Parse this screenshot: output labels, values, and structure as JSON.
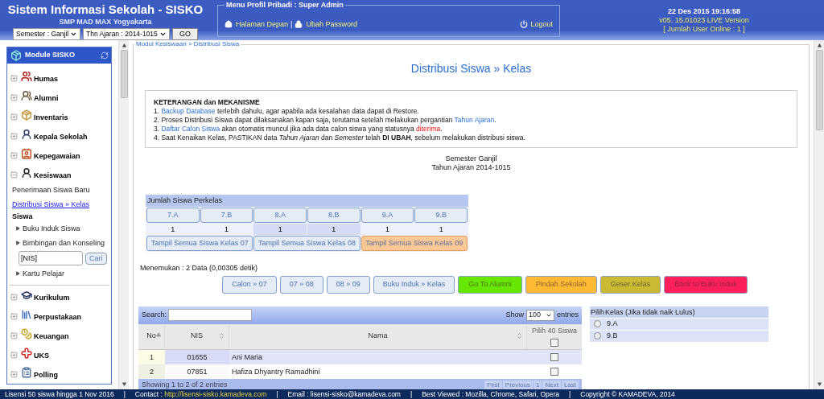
{
  "header": {
    "title": "Sistem Informasi Sekolah - SISKO",
    "school": "SMP MAD MAX Yogyakarta",
    "semester_select": "Semester : Ganjil",
    "year_select": "Thn Ajaran : 2014-1015",
    "go_button": "GO"
  },
  "profile_menu": {
    "legend": "Menu Profil Pribadi : Super Admin",
    "links": [
      "Halaman Depan",
      "Ubah Password"
    ],
    "separator": "|",
    "logout": "Logout"
  },
  "info": {
    "datetime": "22 Des 2015 19:16:58",
    "version": "v05. 15.01023 LIVE Version",
    "users_online": "[ Jumlah User Online : 1 ]"
  },
  "sidebar": {
    "title": "Module SISKO",
    "modules": [
      {
        "label": "Humas",
        "expanded": false
      },
      {
        "label": "Alumni",
        "expanded": false
      },
      {
        "label": "Inventaris",
        "expanded": false
      },
      {
        "label": "Kepala Sekolah",
        "expanded": false
      },
      {
        "label": "Kepegawaian",
        "expanded": false
      },
      {
        "label": "Kesiswaan",
        "expanded": true,
        "submenu": [
          {
            "kind": "item",
            "label": "Penerimaan Siswa Baru",
            "selected": false
          },
          {
            "kind": "item",
            "label": "Distribusi Siswa » Kelas",
            "selected": true
          },
          {
            "kind": "heading",
            "label": "Siswa"
          },
          {
            "kind": "arrow",
            "label": "Buku Induk Siswa"
          },
          {
            "kind": "arrow",
            "label": "Bimbingan dan Konseling"
          },
          {
            "kind": "search",
            "value": "[NIS]",
            "button": "Cari"
          },
          {
            "kind": "arrow",
            "label": "Kartu Pelajar"
          }
        ]
      },
      {
        "label": "Kurikulum",
        "expanded": false
      },
      {
        "label": "Perpustakaan",
        "expanded": false
      },
      {
        "label": "Keuangan",
        "expanded": false
      },
      {
        "label": "UKS",
        "expanded": false
      },
      {
        "label": "Polling",
        "expanded": false
      }
    ]
  },
  "main": {
    "breadcrumb": "Modul Kesiswaan > Distribusi Siswa",
    "title": "Distribusi Siswa » Kelas",
    "notes": {
      "heading": "KETERANGAN dan MEKANISME",
      "items": [
        [
          {
            "kind": "text",
            "text": "1. "
          },
          {
            "kind": "link",
            "text": "Backup Database"
          },
          {
            "kind": "text",
            "text": " terlebih dahulu, agar apabila ada kesalahan data dapat di Restore."
          }
        ],
        [
          {
            "kind": "text",
            "text": "2. Proses Distribusi Siswa dapat dilaksanakan kapan saja, terutama setelah melakukan pergantian "
          },
          {
            "kind": "link",
            "text": "Tahun Ajaran"
          },
          {
            "kind": "text",
            "text": "."
          }
        ],
        [
          {
            "kind": "text",
            "text": "3. "
          },
          {
            "kind": "link",
            "text": "Daftar Calon Siswa"
          },
          {
            "kind": "text",
            "text": " akan otomatis muncul jika ada data calon siswa yang statusnya "
          },
          {
            "kind": "alert",
            "text": "diterima"
          },
          {
            "kind": "text",
            "text": "."
          }
        ],
        [
          {
            "kind": "text",
            "text": "4. Saat Kenaikan Kelas, PASTIKAN data "
          },
          {
            "kind": "italic",
            "text": "Tahun Ajaran"
          },
          {
            "kind": "text",
            "text": " dan "
          },
          {
            "kind": "italic",
            "text": "Semester"
          },
          {
            "kind": "text",
            "text": " telah "
          },
          {
            "kind": "bold",
            "text": "DI UBAH"
          },
          {
            "kind": "text",
            "text": ", sebelum melakukan distribusi siswa."
          }
        ]
      ]
    },
    "semester": "Semester Ganjil",
    "year": "Tahun Ajaran 2014-1015",
    "class_table": {
      "title": "Jumlah Siswa Perkelas",
      "classes": [
        {
          "label": "7.A",
          "count": "1",
          "highlighted": false
        },
        {
          "label": "7.B",
          "count": "1",
          "highlighted": false
        },
        {
          "label": "8.A",
          "count": "1",
          "highlighted": true
        },
        {
          "label": "8.B",
          "count": "1",
          "highlighted": true
        },
        {
          "label": "9.A",
          "count": "1",
          "highlighted": false
        },
        {
          "label": "9.B",
          "count": "1",
          "highlighted": false
        }
      ],
      "show_all": [
        {
          "label": "Tampil Semua Siswa Kelas 07",
          "selected": false
        },
        {
          "label": "Tampil Semua Siswa Kelas 08",
          "selected": false
        },
        {
          "label": "Tampil Semua Siswa Kelas 09",
          "selected": true
        }
      ]
    },
    "result": "Menemukan : 2 Data (0,00305 detik)",
    "actions": [
      {
        "kind": "default",
        "label": "Calon » 07"
      },
      {
        "kind": "default",
        "label": "07 » 08"
      },
      {
        "kind": "default",
        "label": "08 » 09"
      },
      {
        "kind": "default",
        "label": "Buku Induk » Kelas"
      },
      {
        "kind": "colored",
        "label": "Go To Alumni",
        "color": "#66e600"
      },
      {
        "kind": "colored",
        "label": "Pindah Sekolah",
        "color": "#ffb933"
      },
      {
        "kind": "colored",
        "label": "Geser Kelas",
        "color": "#c9b933"
      },
      {
        "kind": "colored",
        "label": "Back to Buku Induk",
        "color": "#ff1f5a"
      }
    ],
    "datatable": {
      "search_label": "Search:",
      "show_label": "Show",
      "page_length": "100",
      "entries_label": "entries",
      "columns": [
        {
          "label": "No",
          "sorted": true
        },
        {
          "label": "NIS",
          "sorted": false
        },
        {
          "label": "Nama",
          "sorted": false
        }
      ],
      "select_column": {
        "label": "Pilih 40 Siswa",
        "checked": false
      },
      "rows": [
        {
          "no": "1",
          "nis": "01655",
          "nama": "Ani Maria",
          "checked": false
        },
        {
          "no": "2",
          "nis": "07851",
          "nama": "Hafiza Dhyantry Ramadhini",
          "checked": false
        }
      ],
      "info": "Showing 1 to 2 of 2 entries",
      "pagination": [
        {
          "label": "First",
          "disabled": true
        },
        {
          "label": "Previous",
          "disabled": true
        },
        {
          "label": "1",
          "disabled": true
        },
        {
          "label": "Next",
          "disabled": true
        },
        {
          "label": "Last",
          "disabled": true
        }
      ]
    },
    "kelas_table": {
      "columns": [
        "Pilih",
        "Kelas (Jika tidak naik Lulus)"
      ],
      "rows": [
        {
          "label": "9.A",
          "selected": false
        },
        {
          "label": "9.B",
          "selected": false
        }
      ]
    }
  },
  "footer": [
    {
      "kind": "text",
      "text": "Lisensi 50 siswa hingga 1 Nov 2016"
    },
    {
      "kind": "link",
      "label": "Contact : ",
      "text": "http://lisensi-sisko.kamadeva.com"
    },
    {
      "kind": "text",
      "text": "Email : lisensi-sisko@kamadeva.com"
    },
    {
      "kind": "text",
      "text": "Best Viewed : Mozilla, Chrome, Safari, Opera"
    },
    {
      "kind": "text",
      "text": "Copyright © KAMADEVA, 2014"
    }
  ],
  "footer_separator": "|"
}
